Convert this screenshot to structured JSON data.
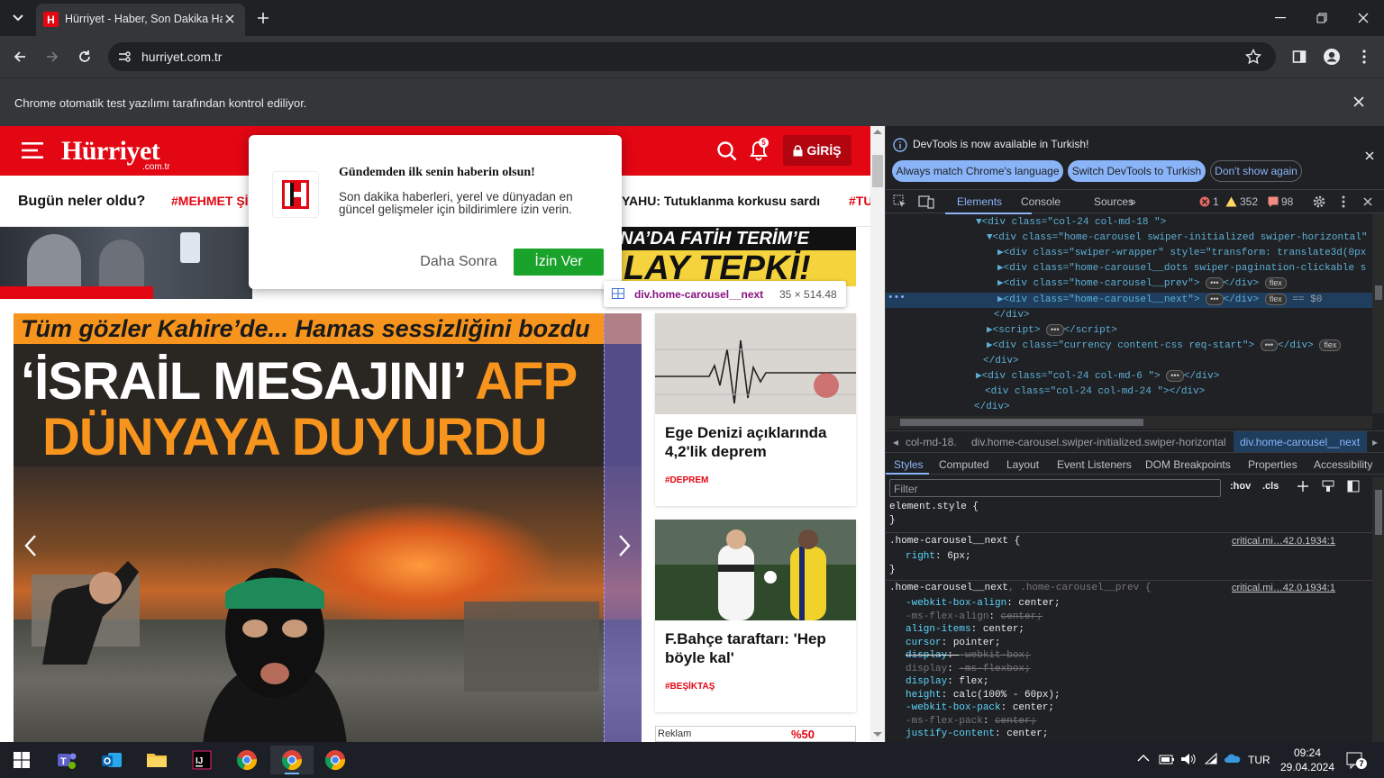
{
  "browser": {
    "tab_title": "Hürriyet - Haber, Son Dakika Haberleri",
    "tab_favicon_letter": "H",
    "url": "hurriyet.com.tr",
    "infobar_text": "Chrome otomatik test yazılımı tarafından kontrol ediliyor."
  },
  "site": {
    "logo": "Hürriyet",
    "logo_sub": ".com.tr",
    "login_label": "GİRİŞ",
    "notification_count": "5",
    "nav_question": "Bugün neler oldu?",
    "nav_items": [
      "#MEHMET Şİ",
      "YAHU: Tutuklanma korkusu sardı",
      "#TU"
    ],
    "ad_text_1": "NA’DA FATİH TERİM’E",
    "ad_text_2": "LAY TEPKİ!",
    "carousel": {
      "banner": "Tüm gözler Kahire’de... Hamas sessizliğini bozdu",
      "line1_white": "‘İSRAİL MESAJINI’ ",
      "line1_orange": "AFP",
      "line2": "DÜNYAYA DUYURDU"
    },
    "cards": [
      {
        "title": "Ege Denizi açıklarında 4,2'lik deprem",
        "tag": "#DEPREM"
      },
      {
        "title": "F.Bahçe taraftarı: 'Hep böyle kal'",
        "tag": "#BEŞİKTAŞ"
      }
    ],
    "ad_label": "Reklam",
    "ad_percent": "%50"
  },
  "popup": {
    "title": "Gündemden ilk senin haberin olsun!",
    "body": "Son dakika haberleri, yerel ve dünyadan en güncel gelişmeler için bildirimlere izin verin.",
    "cancel": "Daha Sonra",
    "ok": "İzin Ver"
  },
  "inspect_tooltip": {
    "selector": "div.home-carousel__next",
    "size": "35 × 514.48"
  },
  "devtools": {
    "notice": "DevTools is now available in Turkish!",
    "btn_match": "Always match Chrome's language",
    "btn_switch": "Switch DevTools to Turkish",
    "btn_dont": "Don't show again",
    "tabs": [
      "Elements",
      "Console",
      "Sources"
    ],
    "errors": "1",
    "warnings": "352",
    "issues": "98",
    "dom_lines": [
      "▼<div class=\"col-24  col-md-18  \">",
      "▼<div class=\"home-carousel swiper-initialized swiper-horizontal\"",
      "▶<div class=\"swiper-wrapper\" style=\"transform: translate3d(0px",
      "▶<div class=\"home-carousel__dots swiper-pagination-clickable s",
      "▶<div class=\"home-carousel__prev\">",
      "▶<div class=\"home-carousel__next\">",
      "</div>",
      "▶<script>",
      "▶<div class=\"currency content-css req-start\">",
      "</div>",
      "▶<div class=\"col-24  col-md-6  \">",
      "<div class=\"col-24  col-md-24  \"></div>",
      "</div>"
    ],
    "selected_suffix": "== $0",
    "crumbs": [
      "col-md-18.",
      "div.home-carousel.swiper-initialized.swiper-horizontal",
      "div.home-carousel__next"
    ],
    "style_tabs": [
      "Styles",
      "Computed",
      "Layout",
      "Event Listeners",
      "DOM Breakpoints",
      "Properties",
      "Accessibility"
    ],
    "filter_placeholder": "Filter",
    "hov": ":hov",
    "cls": ".cls",
    "rules": {
      "element_style": "element.style {",
      "rule1_selector": ".home-carousel__next {",
      "rule1_source": "critical.mi…42.0.1934:1",
      "rule1_prop": "right",
      "rule1_val": "6px;",
      "rule2_selector": ".home-carousel__next",
      "rule2_selector_b": ", .home-carousel__prev {",
      "rule2_source": "critical.mi…42.0.1934:1",
      "props": [
        {
          "name": "-webkit-box-align",
          "value": "center;",
          "state": "normal"
        },
        {
          "name": "-ms-flex-align",
          "value": "center;",
          "state": "dim"
        },
        {
          "name": "align-items",
          "value": "center;",
          "state": "normal"
        },
        {
          "name": "cursor",
          "value": "pointer;",
          "state": "normal"
        },
        {
          "name": "display",
          "value": "-webkit-box;",
          "state": "strike"
        },
        {
          "name": "display",
          "value": "-ms-flexbox;",
          "state": "dim"
        },
        {
          "name": "display",
          "value": "flex;",
          "state": "normal"
        },
        {
          "name": "height",
          "value": "calc(100% - 60px);",
          "state": "normal"
        },
        {
          "name": "-webkit-box-pack",
          "value": "center;",
          "state": "normal"
        },
        {
          "name": "-ms-flex-pack",
          "value": "center;",
          "state": "dim"
        },
        {
          "name": "justify-content",
          "value": "center;",
          "state": "normal"
        }
      ]
    }
  },
  "taskbar": {
    "lang": "TUR",
    "time": "09:24",
    "date": "29.04.2024",
    "notif_count": "7"
  },
  "colors": {
    "brand_red": "#e30613",
    "accept_green": "#1aa32a",
    "devtools_bg": "#202124",
    "devtools_selected": "#1f3e5e"
  }
}
